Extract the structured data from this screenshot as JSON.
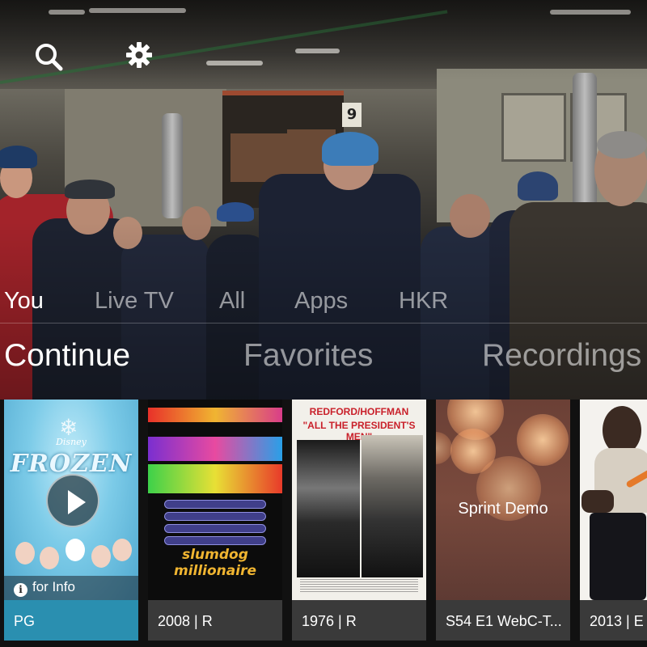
{
  "nav": {
    "tabs": [
      {
        "label": "You",
        "active": true
      },
      {
        "label": "Live TV",
        "active": false
      },
      {
        "label": "All",
        "active": false
      },
      {
        "label": "Apps",
        "active": false
      },
      {
        "label": "HKR",
        "active": false
      }
    ]
  },
  "subnav": {
    "tabs": [
      {
        "label": "Continue",
        "active": true
      },
      {
        "label": "Favorites",
        "active": false
      },
      {
        "label": "Recordings",
        "active": false
      }
    ]
  },
  "icons": {
    "search": "search-icon",
    "settings": "gear-icon"
  },
  "carousel": {
    "cards": [
      {
        "poster_text": {
          "brand": "Disney",
          "title": "FROZEN"
        },
        "info_label": "for Info",
        "meta": "PG",
        "selected": true
      },
      {
        "poster_text": {
          "title": "slumdog millionaire"
        },
        "meta": "2008 | R",
        "selected": false
      },
      {
        "poster_text": {
          "line1": "REDFORD/HOFFMAN",
          "line2": "\"ALL THE PRESIDENT'S MEN\""
        },
        "meta": "1976 | R",
        "selected": false
      },
      {
        "poster_text": {
          "title": "Sprint Demo"
        },
        "meta": "S54 E1 WebC-T...",
        "selected": false
      },
      {
        "poster_text": {},
        "meta": "2013 | E",
        "selected": false
      }
    ]
  },
  "colors": {
    "accent": "#35b6e0",
    "selected_meta_bg": "#2a8fb0",
    "meta_bg": "#3a3a3a",
    "meta_bar": "#9a6b2f"
  }
}
